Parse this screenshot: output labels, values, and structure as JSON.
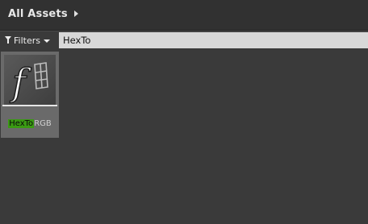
{
  "path": {
    "root_label": "All Assets"
  },
  "filters": {
    "label": "Filters"
  },
  "search": {
    "value": "HexTo"
  },
  "assets": [
    {
      "name_match": "HexTo",
      "name_rest": "RGB",
      "icon": "function-icon"
    }
  ],
  "colors": {
    "highlight": "#3a9a13",
    "tile_bg": "#6a6a6a",
    "panel_bg": "#3a3a3a"
  }
}
